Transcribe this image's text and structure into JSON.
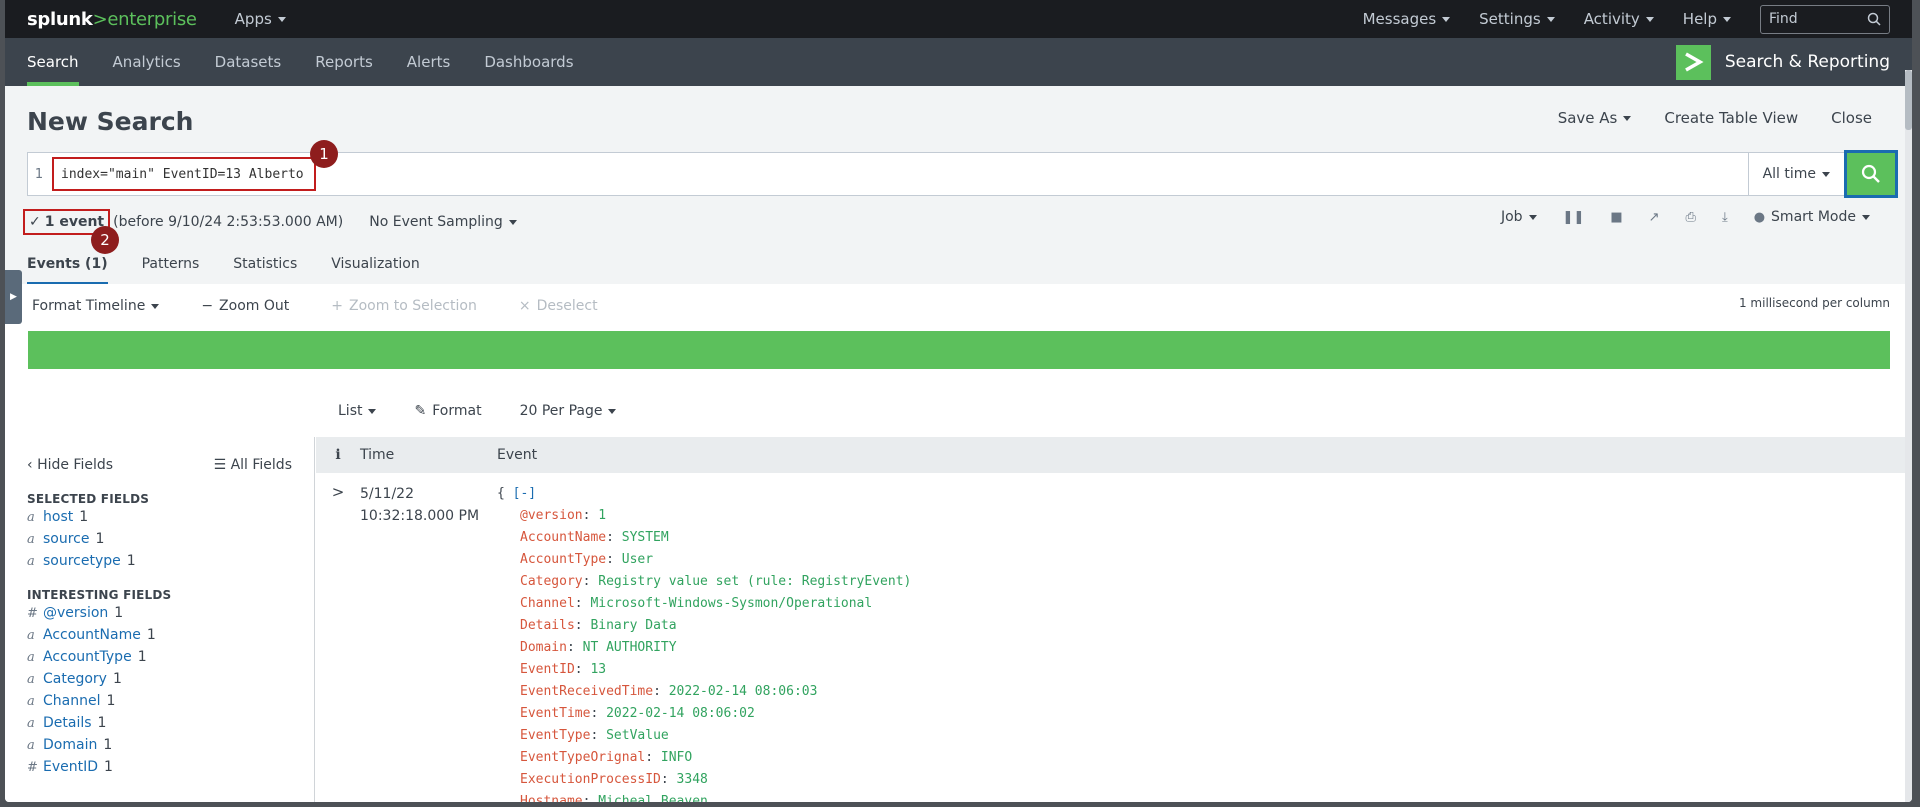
{
  "topbar": {
    "logo_splunk": "splunk",
    "logo_gt": ">",
    "logo_enterprise": "enterprise",
    "apps": "Apps",
    "messages": "Messages",
    "settings": "Settings",
    "activity": "Activity",
    "help": "Help",
    "find_placeholder": "Find"
  },
  "appbar": {
    "tabs": [
      "Search",
      "Analytics",
      "Datasets",
      "Reports",
      "Alerts",
      "Dashboards"
    ],
    "app_title": "Search & Reporting"
  },
  "search": {
    "title": "New Search",
    "save_as": "Save As",
    "create_table_view": "Create Table View",
    "close": "Close",
    "line_number": "1",
    "query": "index=\"main\" EventID=13 Alberto",
    "time_range": "All time"
  },
  "callouts": [
    "1",
    "2"
  ],
  "status": {
    "check": "✓",
    "event_count": "1 event",
    "before": "(before 9/10/24 2:53:53.000 AM)",
    "sampling": "No Event Sampling",
    "job": "Job",
    "mode": "Smart Mode"
  },
  "tabs": [
    "Events (1)",
    "Patterns",
    "Statistics",
    "Visualization"
  ],
  "timeline": {
    "format": "Format Timeline",
    "zoom_out": "Zoom Out",
    "zoom_selection": "Zoom to Selection",
    "deselect": "Deselect",
    "scale": "1 millisecond per column"
  },
  "results_toolbar": {
    "list": "List",
    "format": "Format",
    "per_page": "20 Per Page"
  },
  "sidebar": {
    "hide_fields": "Hide Fields",
    "all_fields": "All Fields",
    "selected_heading": "SELECTED FIELDS",
    "selected": [
      {
        "type": "a",
        "name": "host",
        "count": "1"
      },
      {
        "type": "a",
        "name": "source",
        "count": "1"
      },
      {
        "type": "a",
        "name": "sourcetype",
        "count": "1"
      }
    ],
    "interesting_heading": "INTERESTING FIELDS",
    "interesting": [
      {
        "type": "#",
        "name": "@version",
        "count": "1"
      },
      {
        "type": "a",
        "name": "AccountName",
        "count": "1"
      },
      {
        "type": "a",
        "name": "AccountType",
        "count": "1"
      },
      {
        "type": "a",
        "name": "Category",
        "count": "1"
      },
      {
        "type": "a",
        "name": "Channel",
        "count": "1"
      },
      {
        "type": "a",
        "name": "Details",
        "count": "1"
      },
      {
        "type": "a",
        "name": "Domain",
        "count": "1"
      },
      {
        "type": "#",
        "name": "EventID",
        "count": "1"
      }
    ]
  },
  "events": {
    "col_info": "i",
    "col_time": "Time",
    "col_event": "Event",
    "row": {
      "expander": ">",
      "date": "5/11/22",
      "time": "10:32:18.000 PM",
      "open_brace": "{",
      "toggle": "[-]",
      "fields": [
        {
          "key": "@version",
          "value": "1"
        },
        {
          "key": "AccountName",
          "value": "SYSTEM"
        },
        {
          "key": "AccountType",
          "value": "User"
        },
        {
          "key": "Category",
          "value": "Registry value set (rule: RegistryEvent)"
        },
        {
          "key": "Channel",
          "value": "Microsoft-Windows-Sysmon/Operational"
        },
        {
          "key": "Details",
          "value": "Binary Data"
        },
        {
          "key": "Domain",
          "value": "NT AUTHORITY"
        },
        {
          "key": "EventID",
          "value": "13"
        },
        {
          "key": "EventReceivedTime",
          "value": "2022-02-14 08:06:03"
        },
        {
          "key": "EventTime",
          "value": "2022-02-14 08:06:02"
        },
        {
          "key": "EventType",
          "value": "SetValue"
        },
        {
          "key": "EventTypeOrignal",
          "value": "INFO"
        },
        {
          "key": "ExecutionProcessID",
          "value": "3348"
        },
        {
          "key": "Hostname",
          "value": "Micheal.Beaven"
        }
      ]
    }
  },
  "colors": {
    "accent_green": "#5cc05c",
    "callout_red": "#8e1d1d",
    "highlight_red": "#c21d1d",
    "link_blue": "#1a6cb0",
    "key_color": "#d6563c",
    "value_color": "#31a35f"
  }
}
